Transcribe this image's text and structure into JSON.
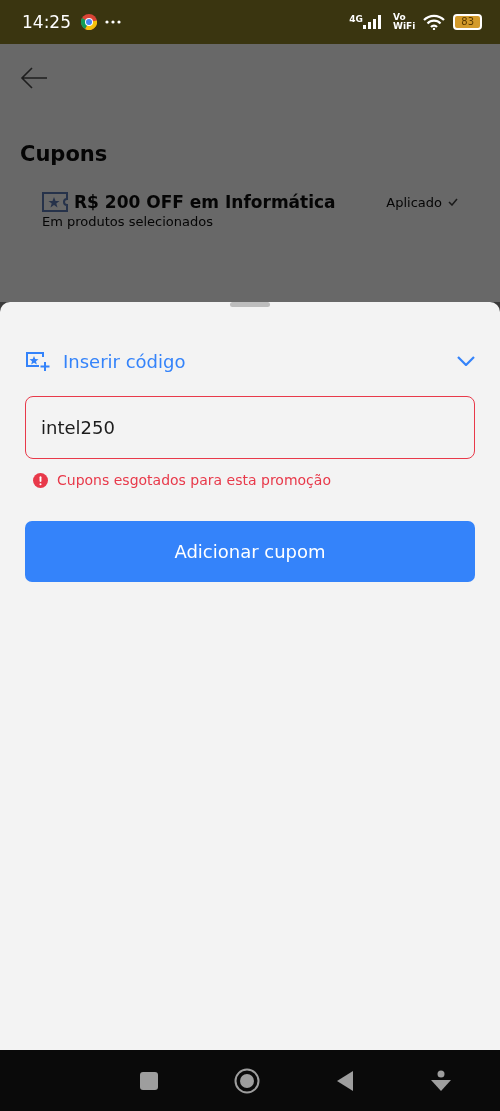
{
  "status_bar": {
    "time": "14:25",
    "network": "4G",
    "volte": "Vo",
    "wifi_label": "WiFi",
    "battery": "83"
  },
  "page": {
    "title": "Cupons",
    "coupons": [
      {
        "title": "R$ 200 OFF em Informática",
        "subtitle": "Em produtos selecionados",
        "status": "Aplicado",
        "applied": true
      }
    ]
  },
  "sheet": {
    "section_title": "Inserir código",
    "expanded": true,
    "input": {
      "value": "intel250",
      "error": true
    },
    "error_message": "Cupons esgotados para esta promoção",
    "button": "Adicionar cupom"
  }
}
